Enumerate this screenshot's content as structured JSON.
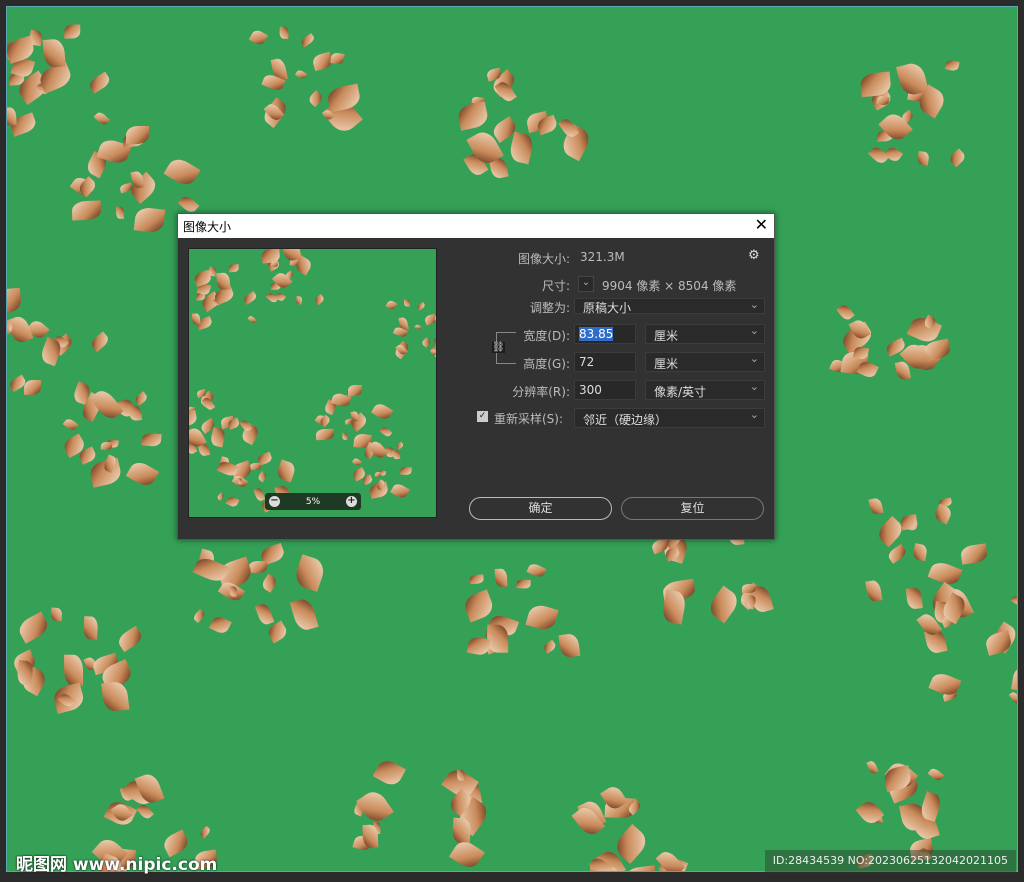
{
  "watermark": {
    "logo_text": "昵图网",
    "site": "www.nipic.com",
    "id_text": "ID:28434539 NO:20230625132042021105"
  },
  "dialog": {
    "title": "图像大小",
    "image_size_label": "图像大小:",
    "image_size_value": "321.3M",
    "dimensions_label": "尺寸:",
    "dimensions_value": "9904 像素 × 8504 像素",
    "fit_to_label": "调整为:",
    "fit_to_value": "原稿大小",
    "width_label": "宽度(D):",
    "width_value": "83.85",
    "width_unit": "厘米",
    "height_label": "高度(G):",
    "height_value": "72",
    "height_unit": "厘米",
    "resolution_label": "分辨率(R):",
    "resolution_value": "300",
    "resolution_unit": "像素/英寸",
    "resample_label": "重新采样(S):",
    "resample_checked": true,
    "resample_value": "邻近（硬边缘）",
    "zoom_value": "5%",
    "ok_label": "确定",
    "reset_label": "复位"
  }
}
